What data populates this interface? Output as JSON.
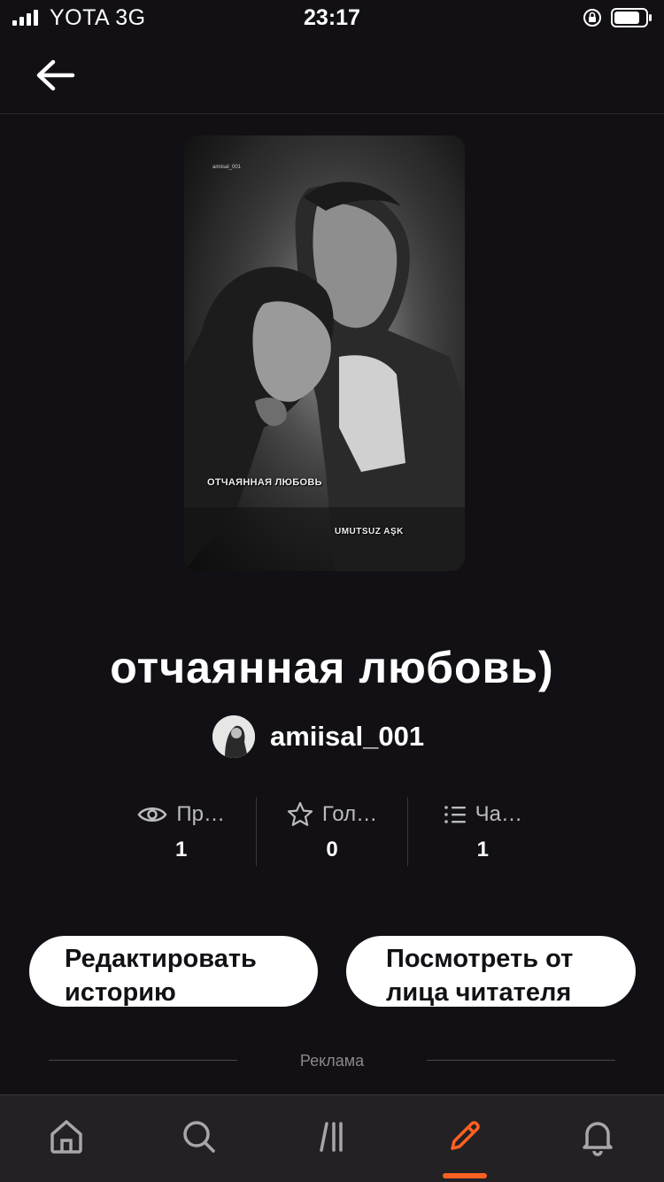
{
  "status_bar": {
    "carrier": "YOTA   3G",
    "time": "23:17"
  },
  "cover": {
    "title_text": "ОТЧАЯННАЯ ЛЮБОВЬ",
    "subtitle_text": "UMUTSUZ AŞK",
    "watermark": "amiisal_001"
  },
  "story": {
    "title": "отчаянная любовь)",
    "author": "amiisal_001"
  },
  "stats": [
    {
      "icon": "eye-icon",
      "label": "Пр…",
      "value": "1"
    },
    {
      "icon": "star-icon",
      "label": "Гол…",
      "value": "0"
    },
    {
      "icon": "list-icon",
      "label": "Ча…",
      "value": "1"
    }
  ],
  "buttons": {
    "edit_line1": "Редактировать",
    "edit_line2": "историю",
    "view_line1": "Посмотреть от",
    "view_line2": "лица читателя"
  },
  "ad": {
    "label": "Реклама"
  },
  "nav": {
    "active": "write",
    "accent": "#ff6122",
    "items": [
      "home-icon",
      "search-icon",
      "library-icon",
      "write-icon",
      "notifications-icon"
    ]
  }
}
